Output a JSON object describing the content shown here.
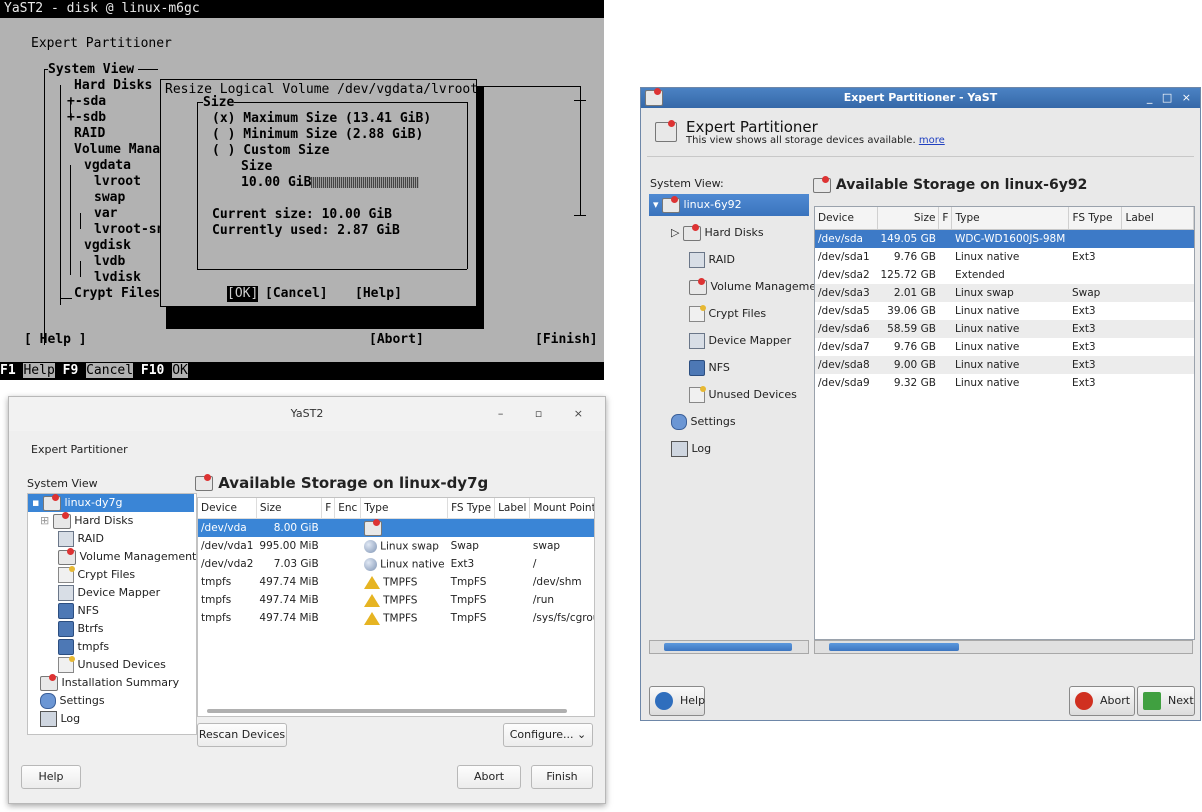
{
  "terminal": {
    "title": "YaST2 - disk @ linux-m6gc",
    "heading": "Expert Partitioner",
    "system_view_label": "System View",
    "tree": [
      "Hard Disks",
      "+-sda",
      "+-sdb",
      "RAID",
      "Volume Mana",
      "vgdata",
      "lvroot",
      "swap",
      "var",
      "lvroot-sn",
      "vgdisk",
      "lvdb",
      "lvdisk",
      "Crypt Files"
    ],
    "dialog": {
      "title": "Resize Logical Volume /dev/vgdata/lvroot",
      "group": "Size",
      "opt_max": "(x) Maximum Size (13.41 GiB)",
      "opt_min": "( ) Minimum Size (2.88 GiB)",
      "opt_custom": "( ) Custom Size",
      "size_label": "Size",
      "size_value": "10.00 GiB",
      "current_size": "Current size: 10.00 GiB",
      "currently_used": "Currently used: 2.87 GiB",
      "ok": "[OK]",
      "cancel": "[Cancel]",
      "help": "[Help]"
    },
    "bottom": {
      "help": "[ Help ]",
      "abort": "[Abort]",
      "finish": "[Finish]"
    },
    "fkeys": {
      "f1": "F1",
      "f1_label": "Help",
      "f9": "F9",
      "f9_label": "Cancel",
      "f10": "F10",
      "f10_label": "OK"
    }
  },
  "kde": {
    "window_title": "Expert Partitioner - YaST",
    "header_title": "Expert Partitioner",
    "header_sub": "This view shows all storage devices available.",
    "header_link": "more",
    "system_view_label": "System View:",
    "tree": {
      "host": "linux-6y92",
      "hard_disks": "Hard Disks",
      "raid": "RAID",
      "volume": "Volume Manageme",
      "crypt": "Crypt Files",
      "device_mapper": "Device Mapper",
      "nfs": "NFS",
      "unused": "Unused Devices",
      "settings": "Settings",
      "log": "Log"
    },
    "panel_title": "Available Storage on linux-6y92",
    "columns": [
      "Device",
      "Size",
      "F",
      "Type",
      "FS Type",
      "Label"
    ],
    "rows": [
      {
        "device": "/dev/sda",
        "size": "149.05 GB",
        "f": "",
        "type": "WDC-WD1600JS-98M",
        "fs": "",
        "label": ""
      },
      {
        "device": "/dev/sda1",
        "size": "9.76 GB",
        "f": "",
        "type": "Linux native",
        "fs": "Ext3",
        "label": ""
      },
      {
        "device": "/dev/sda2",
        "size": "125.72 GB",
        "f": "",
        "type": "Extended",
        "fs": "",
        "label": ""
      },
      {
        "device": "/dev/sda3",
        "size": "2.01 GB",
        "f": "",
        "type": "Linux swap",
        "fs": "Swap",
        "label": ""
      },
      {
        "device": "/dev/sda5",
        "size": "39.06 GB",
        "f": "",
        "type": "Linux native",
        "fs": "Ext3",
        "label": ""
      },
      {
        "device": "/dev/sda6",
        "size": "58.59 GB",
        "f": "",
        "type": "Linux native",
        "fs": "Ext3",
        "label": ""
      },
      {
        "device": "/dev/sda7",
        "size": "9.76 GB",
        "f": "",
        "type": "Linux native",
        "fs": "Ext3",
        "label": ""
      },
      {
        "device": "/dev/sda8",
        "size": "9.00 GB",
        "f": "",
        "type": "Linux native",
        "fs": "Ext3",
        "label": ""
      },
      {
        "device": "/dev/sda9",
        "size": "9.32 GB",
        "f": "",
        "type": "Linux native",
        "fs": "Ext3",
        "label": ""
      }
    ],
    "buttons": {
      "help": "Help",
      "abort": "Abort",
      "next": "Next"
    },
    "window_controls": "_ □ ×"
  },
  "gnome": {
    "window_title": "YaST2",
    "window_controls": "– ▫ ×",
    "heading": "Expert Partitioner",
    "system_view_label": "System View",
    "tree": {
      "host": "linux-dy7g",
      "hard_disks": "Hard Disks",
      "raid": "RAID",
      "volume": "Volume Management",
      "crypt": "Crypt Files",
      "device_mapper": "Device Mapper",
      "nfs": "NFS",
      "btrfs": "Btrfs",
      "tmpfs": "tmpfs",
      "unused": "Unused Devices",
      "install_summary": "Installation Summary",
      "settings": "Settings",
      "log": "Log"
    },
    "panel_title": "Available Storage on linux-dy7g",
    "columns": [
      "Device",
      "Size",
      "F",
      "Enc",
      "Type",
      "FS Type",
      "Label",
      "Mount Point"
    ],
    "rows": [
      {
        "device": "/dev/vda",
        "size": "8.00 GiB",
        "type": "",
        "fs": "",
        "mount": ""
      },
      {
        "device": "/dev/vda1",
        "size": "995.00 MiB",
        "type": "Linux swap",
        "fs": "Swap",
        "mount": "swap"
      },
      {
        "device": "/dev/vda2",
        "size": "7.03 GiB",
        "type": "Linux native",
        "fs": "Ext3",
        "mount": "/"
      },
      {
        "device": "tmpfs",
        "size": "497.74 MiB",
        "type": "TMPFS",
        "fs": "TmpFS",
        "mount": "/dev/shm"
      },
      {
        "device": "tmpfs",
        "size": "497.74 MiB",
        "type": "TMPFS",
        "fs": "TmpFS",
        "mount": "/run"
      },
      {
        "device": "tmpfs",
        "size": "497.74 MiB",
        "type": "TMPFS",
        "fs": "TmpFS",
        "mount": "/sys/fs/cgrou"
      }
    ],
    "buttons": {
      "rescan": "Rescan Devices",
      "configure": "Configure...",
      "help": "Help",
      "abort": "Abort",
      "finish": "Finish"
    }
  }
}
